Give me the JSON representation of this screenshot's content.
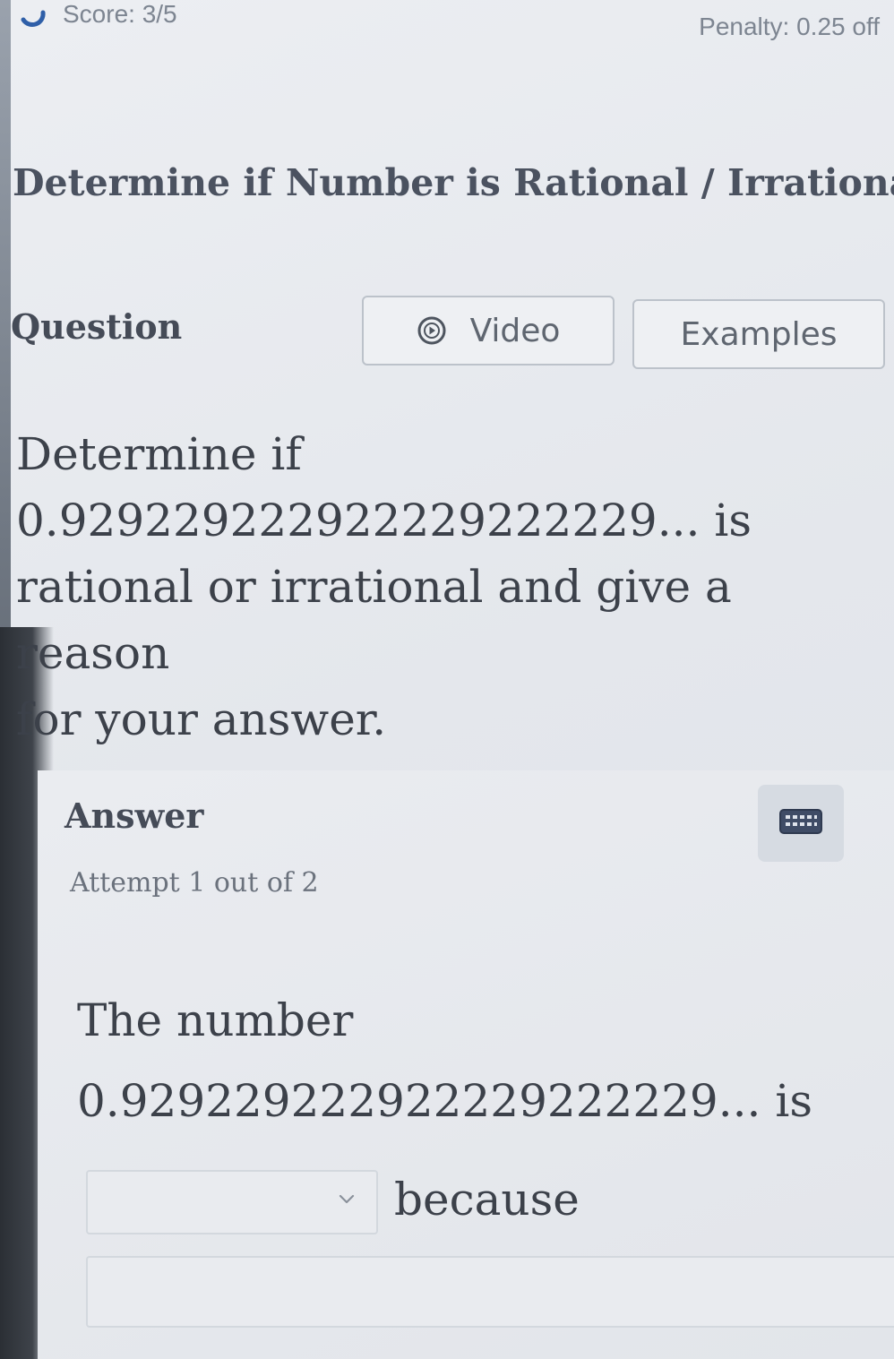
{
  "header": {
    "score": "Score: 3/5",
    "penalty": "Penalty: 0.25 off"
  },
  "title": "Determine if Number is Rational / Irrational",
  "question": {
    "label": "Question",
    "video_label": "Video",
    "examples_label": "Examples",
    "text_line1": "Determine if",
    "text_line2": "0.929229222922229222229... is",
    "text_line3": "rational or irrational and give a reason",
    "text_line4": "for your answer."
  },
  "answer": {
    "label": "Answer",
    "attempt": "Attempt 1 out of 2",
    "line1": "The number",
    "line2": "0.929229222922229222229... is",
    "select_value": "",
    "because": "because",
    "reason_value": ""
  },
  "icons": {
    "score": "score-ring-icon",
    "video": "play-icon",
    "keyboard": "keyboard-icon",
    "dropdown": "chevron-down-icon"
  },
  "colors": {
    "background": "#e6e9ee",
    "text": "#3c414a",
    "muted": "#7d8591",
    "score_accent": "#2f5fa8"
  }
}
